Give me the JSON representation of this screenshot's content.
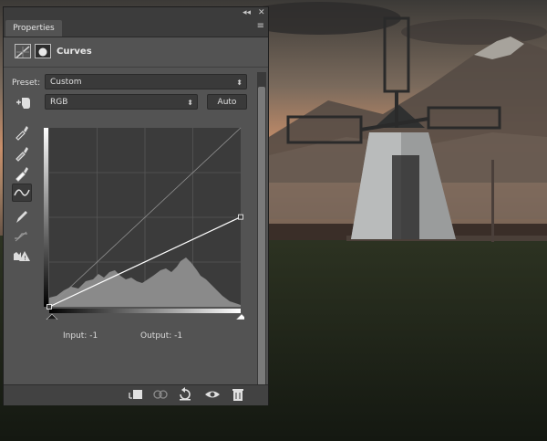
{
  "panel": {
    "tab_label": "Properties",
    "title": "Curves",
    "collapse_glyph": "◂◂",
    "close_glyph": "✕",
    "menu_glyph": "≡"
  },
  "preset": {
    "label": "Preset:",
    "value": "Custom"
  },
  "channel": {
    "value": "RGB"
  },
  "auto_button": "Auto",
  "readout": {
    "input_label": "Input:",
    "input_value": "-1",
    "output_label": "Output:",
    "output_value": "-1"
  },
  "tools": [
    "eyedropper-black-icon",
    "eyedropper-gray-icon",
    "eyedropper-white-icon",
    "curve-edit-icon",
    "pencil-icon",
    "smooth-icon",
    "clipping-warning-icon"
  ],
  "bottom_icons": [
    "clip-to-layer-icon",
    "view-previous-icon",
    "reset-icon",
    "visibility-eye-icon",
    "delete-icon"
  ],
  "curve": {
    "points": [
      [
        0,
        0
      ],
      [
        255,
        128
      ]
    ],
    "grid_divisions": 4
  },
  "colors": {
    "panel_bg": "#535353",
    "graph_bg": "#3b3b3b",
    "histogram": "#8a8a8a",
    "curve_line": "#ffffff"
  }
}
